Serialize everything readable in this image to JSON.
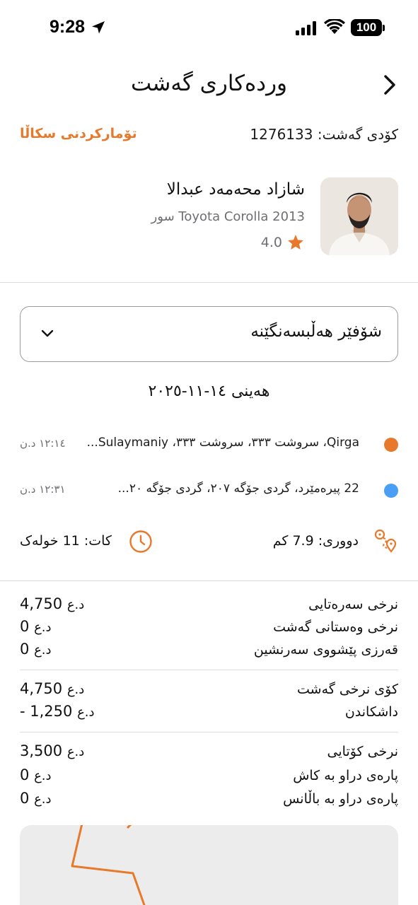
{
  "status_bar": {
    "time": "9:28",
    "battery": "100"
  },
  "header": {
    "title": "وردەکاری گەشت",
    "back_icon": "chevron-right-icon"
  },
  "trip": {
    "code_label": "کۆدی گەشت: 1276133",
    "complaint_label": "تۆمارکردنی سکاڵا"
  },
  "driver": {
    "name": "شازاد محەمەد عبدالا",
    "car": "Toyota Corolla 2013 سور",
    "rating": "4.0"
  },
  "dropdown": {
    "label": "شۆفێر هەڵبسەنگێنە"
  },
  "date": "هەینی  ١٤-١١-٢٠٢٥",
  "locations": [
    {
      "address": "Qirga، سروشت ٣٣٣، سروشت ٣٣٣، Sulaymaniy...",
      "time": "١٢:١٤ د.ن",
      "color": "#e8792b"
    },
    {
      "address": "22 پیرەمێرد، گردی جۆگە ٢٠٧، گردی جۆگە ٢٠...",
      "time": "١٢:٣١ د.ن",
      "color": "#4a9ff5"
    }
  ],
  "stats": {
    "distance": "دووری: 7.9 کم",
    "duration": "کات: 11 خولەک"
  },
  "fares": {
    "group1": [
      {
        "label": "نرخی سەرەتایی",
        "value": "4,750",
        "currency": "د.ع"
      },
      {
        "label": "نرخی وەستانی گەشت",
        "value": "0",
        "currency": "د.ع"
      },
      {
        "label": "قەرزی پێشووی سەرنشین",
        "value": "0",
        "currency": "د.ع"
      }
    ],
    "group2": [
      {
        "label": "کۆی نرخی گەشت",
        "value": "4,750",
        "currency": "د.ع"
      },
      {
        "label": "داشکاندن",
        "value": "- 1,250",
        "currency": "د.ع"
      }
    ],
    "group3": [
      {
        "label": "نرخی کۆتایی",
        "value": "3,500",
        "currency": "د.ع"
      },
      {
        "label": "پارەی دراو بە کاش",
        "value": "0",
        "currency": "د.ع"
      },
      {
        "label": "پارەی دراو بە باڵانس",
        "value": "0",
        "currency": "د.ع"
      }
    ]
  },
  "colors": {
    "accent": "#e8792b",
    "pickup": "#e8792b",
    "dropoff": "#4a9ff5"
  }
}
